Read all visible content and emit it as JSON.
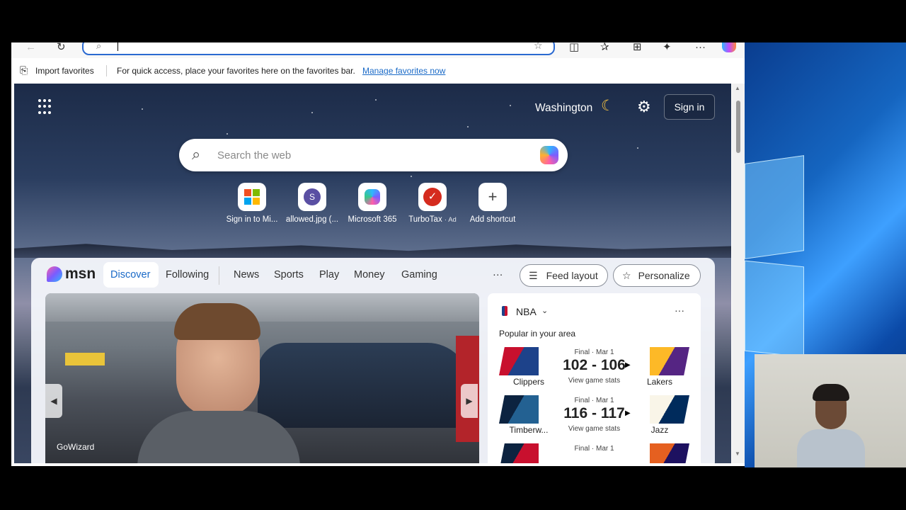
{
  "favorites_bar": {
    "import_label": "Import favorites",
    "hint": "For quick access, place your favorites here on the favorites bar.",
    "manage_link": "Manage favorites now"
  },
  "header": {
    "location": "Washington",
    "sign_in": "Sign in"
  },
  "search": {
    "placeholder": "Search the web"
  },
  "shortcuts": [
    {
      "label": "Sign in to Mi..."
    },
    {
      "label": "allowed.jpg (..."
    },
    {
      "label": "Microsoft 365"
    },
    {
      "label": "TurboTax",
      "ad": "Ad"
    },
    {
      "label": "Add shortcut"
    }
  ],
  "msn": {
    "logo": "msn",
    "tabs": [
      "Discover",
      "Following",
      "News",
      "Sports",
      "Play",
      "Money",
      "Gaming"
    ],
    "more": "···",
    "feed_layout": "Feed layout",
    "personalize": "Personalize"
  },
  "hero": {
    "source": "GoWizard"
  },
  "nba": {
    "league": "NBA",
    "subtitle": "Popular in your area",
    "more": "···",
    "games": [
      {
        "status": "Final · Mar 1",
        "score": "102 - 106",
        "stats": "View game stats",
        "home": "Clippers",
        "away": "Lakers",
        "home_color": "#c8102e",
        "away_color": "#552583"
      },
      {
        "status": "Final · Mar 1",
        "score": "116 - 117",
        "stats": "View game stats",
        "home": "Timberw...",
        "away": "Jazz",
        "home_color": "#0c2340",
        "away_color": "#002b5c"
      },
      {
        "status": "Final · Mar 1",
        "score": "",
        "stats": "",
        "home": "",
        "away": "",
        "home_color": "#0c2340",
        "away_color": "#1d1160"
      }
    ]
  }
}
